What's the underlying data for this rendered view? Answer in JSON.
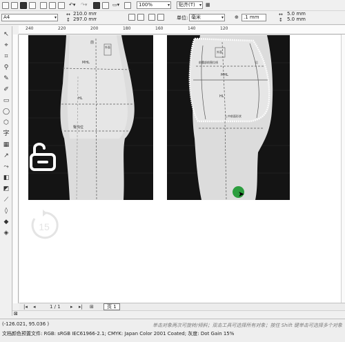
{
  "toolbar": {
    "zoom_value": "100%",
    "units_snap": "贴齐(T)"
  },
  "property_bar": {
    "paper_preset": "A4",
    "width": "210.0 mm",
    "height": "297.0 mm",
    "units_label": "单位:",
    "units_value": "毫米",
    "nudge": ".1 mm",
    "dup_x": "5.0 mm",
    "dup_y": "5.0 mm"
  },
  "ruler": {
    "ticks": [
      "240",
      "220",
      "200",
      "180",
      "160",
      "140",
      "120"
    ]
  },
  "left_photo": {
    "labels": [
      "前",
      "外面",
      "MHL",
      "HL",
      "臀沟位"
    ]
  },
  "right_photo": {
    "labels": [
      "外面",
      "前腰部前围位线",
      "后",
      "MHL",
      "HL",
      "上中前面形状"
    ]
  },
  "page_nav": {
    "first": "|◂",
    "prev": "◂",
    "page_count": "1 / 1",
    "next": "▸",
    "last": "▸|",
    "add": "⊞",
    "page_tab": "页 1"
  },
  "status": {
    "coords": "(-126.021, 95.036 )",
    "hint": "单击对象两次可旋转/倾斜；双击工具可选择所有对象；按住 Shift 键单击可选择多个对象",
    "profile": "文档颜色预置文件: RGB: sRGB IEC61966-2.1; CMYK: Japan Color 2001 Coated; 灰度: Dot Gain 15%"
  },
  "icons": {
    "lock": "lock-open-icon",
    "history": "replay-15-icon",
    "cursor": "arrow-pointer-icon"
  },
  "colors": {
    "cursor_dot": "#2d9e3f",
    "canvas": "#ffffff",
    "chrome": "#f0f0f0"
  }
}
